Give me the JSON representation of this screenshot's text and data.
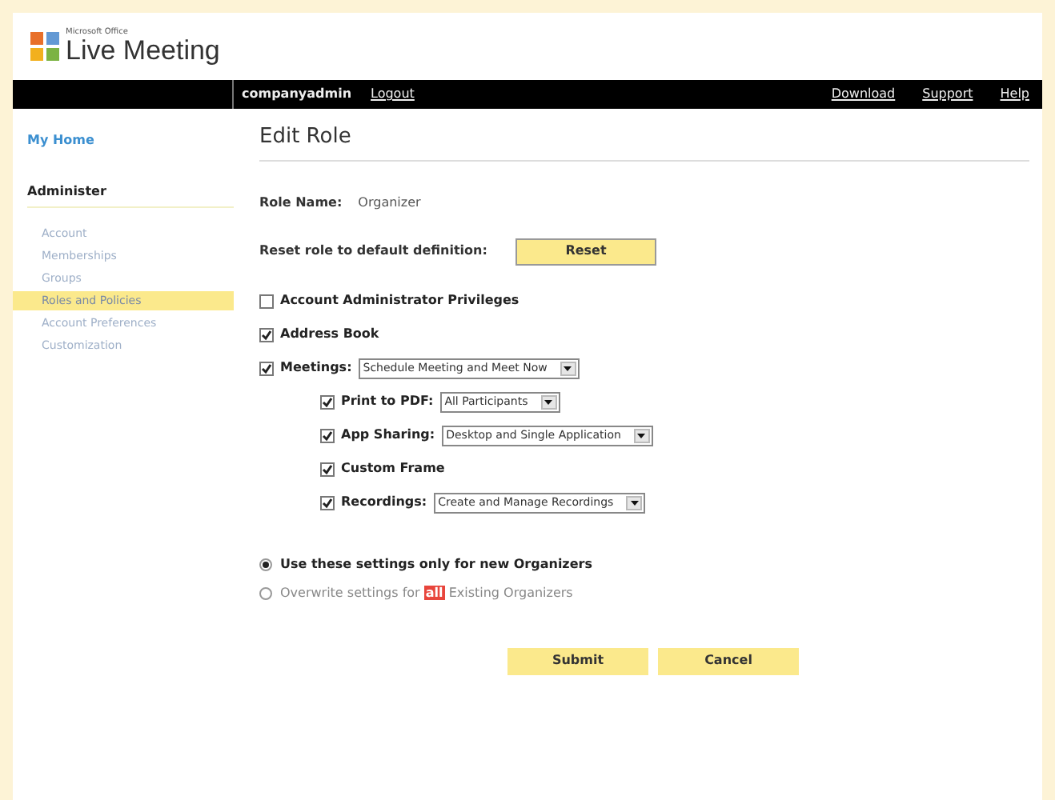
{
  "logo": {
    "small_text": "Microsoft Office",
    "product": "Live Meeting"
  },
  "top_bar": {
    "user": "companyadmin",
    "left_links": [
      "Logout"
    ],
    "right_links": [
      "Download",
      "Support",
      "Help"
    ]
  },
  "sidebar": {
    "home": "My Home",
    "section": "Administer",
    "items": [
      {
        "label": "Account",
        "selected": false
      },
      {
        "label": "Memberships",
        "selected": false
      },
      {
        "label": "Groups",
        "selected": false
      },
      {
        "label": "Roles and Policies",
        "selected": true
      },
      {
        "label": "Account Preferences",
        "selected": false
      },
      {
        "label": "Customization",
        "selected": false
      }
    ]
  },
  "page_title": "Edit Role",
  "role_name": {
    "label": "Role Name:",
    "value": "Organizer"
  },
  "reset": {
    "label": "Reset role to default definition:",
    "button": "Reset"
  },
  "permissions": [
    {
      "label": "Account Administrator Privileges",
      "checked": false
    },
    {
      "label": "Address Book",
      "checked": true
    },
    {
      "label": "Meetings:",
      "checked": true,
      "select": "Schedule Meeting and Meet Now",
      "children": [
        {
          "label": "Print to PDF:",
          "checked": true,
          "select": "All Participants"
        },
        {
          "label": "App Sharing:",
          "checked": true,
          "select": "Desktop and Single Application"
        },
        {
          "label": "Custom Frame",
          "checked": true
        },
        {
          "label": "Recordings:",
          "checked": true,
          "select": "Create and Manage Recordings"
        }
      ]
    }
  ],
  "apply_options": [
    {
      "label": "Use these settings only for new Organizers",
      "selected": true
    },
    {
      "label": "Overwrite settings for **all** Existing Organizers",
      "selected": false
    }
  ],
  "buttons": [
    "Submit",
    "Cancel"
  ]
}
